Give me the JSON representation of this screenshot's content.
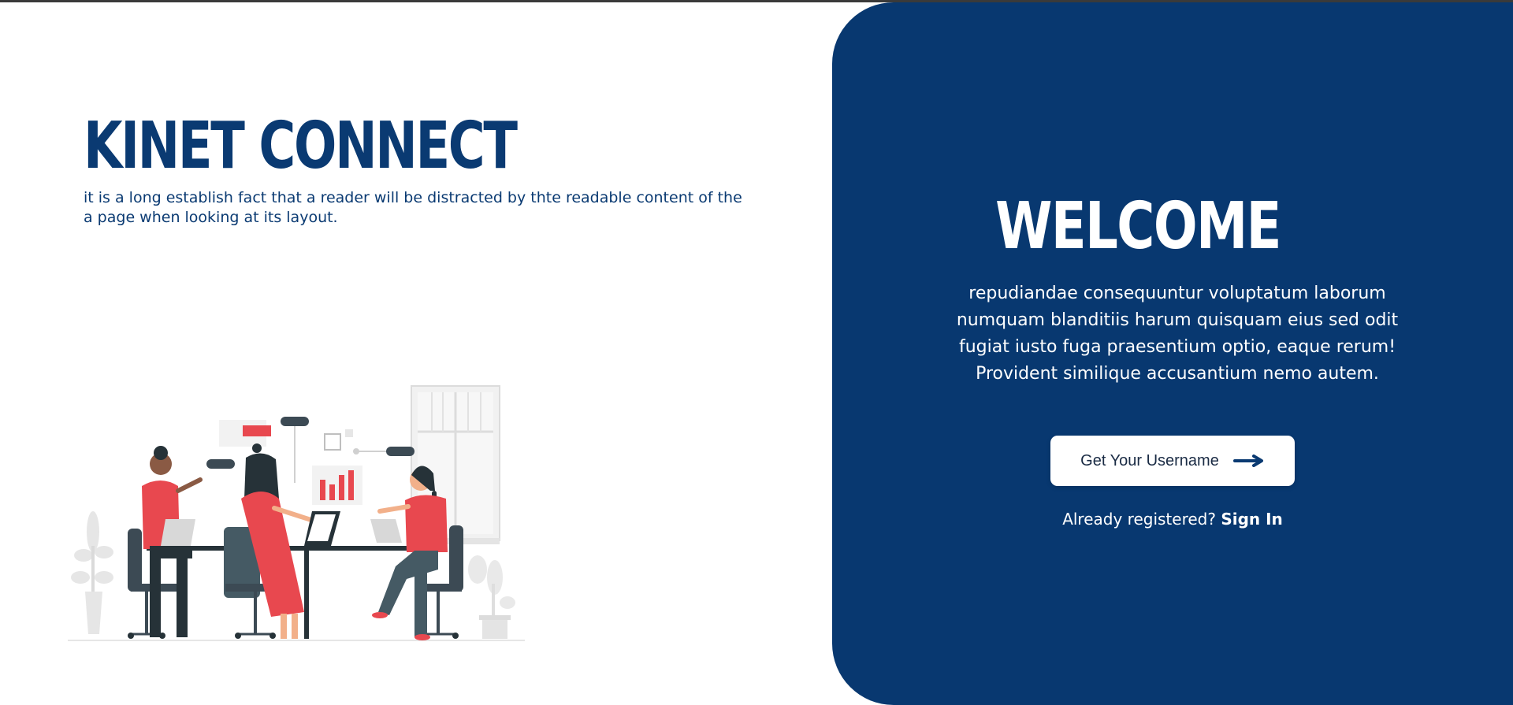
{
  "brand": {
    "title": "KINET CONNECT",
    "description": "it is a long establish fact that a reader will be distracted by thte readable content of the a page when looking at its layout."
  },
  "illustration": {
    "icon": "team-meeting-illustration"
  },
  "welcome": {
    "title": "WELCOME",
    "text": "repudiandae consequuntur voluptatum laborum numquam blanditiis harum quisquam eius sed odit fugiat iusto fuga praesentium optio, eaque rerum! Provident similique accusantium nemo autem.",
    "button_label": "Get Your Username",
    "button_icon": "arrow-right-icon",
    "signin_prompt": "Already registered?",
    "signin_link": "Sign In"
  },
  "colors": {
    "brand_blue": "#0a3a72",
    "panel_blue": "#083870",
    "accent_red": "#e8484f",
    "dark_gray": "#3c4a54"
  }
}
